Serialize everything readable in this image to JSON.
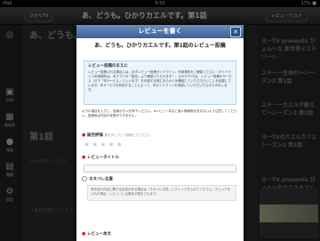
{
  "status": {
    "left": "iPad",
    "time": "9:53",
    "battery": "17% ■"
  },
  "topbar": {
    "tag": "ひかりTV",
    "title": "あ、どうも。ひかりカエルです。第1話",
    "right_button": "レビューリスト"
  },
  "sidebar": {
    "items": [
      {
        "label": "",
        "icon": "home-icon"
      },
      {
        "label": "VOD",
        "icon": "vod-icon"
      },
      {
        "label": "番組表",
        "icon": "program-guide-icon"
      },
      {
        "label": "録画",
        "icon": "recording-icon"
      },
      {
        "label": "書籍",
        "icon": "books-icon"
      },
      {
        "label": "設定",
        "icon": "settings-icon"
      }
    ]
  },
  "background": {
    "heading1": "あ、どうも。ひかりカエルです。第1話",
    "heading2": "第1話",
    "heading3": "ひかりTV、アニメ",
    "text": "「世界のあちらこちら」「何故に出てきた？」",
    "right_items": [
      "ヨーTV presents ぴょん〜な 新世界ミステリーシ",
      "ステーー生命の〜シーズン2 第1話",
      "ステーーカエルが教えて〜シーズン2 第1話",
      "ヨーTVのカエルカフェ シーズン2 第1話",
      "ヨーTV presents ぴょん〜なカエルカフェ シーズン2 第3話"
    ]
  },
  "modal": {
    "header_title": "レビューを書く",
    "close_label": "✕",
    "title": "あ、どうも。ひかりカエルです。第1話のレビュー投稿",
    "notice_heading": "レビュー投稿のまえに",
    "notice_body": "レビュー投稿される場合には、必ずレビュー投稿ガイドライン、利用規約をご確認ください（ガイドライン利用規約は、本アプリの「設定」より確認いただけます）。ひかりTVでは、レビュー投稿のサービス（以下「本サービス」といいます）を利用する際にあらかじめ確認していただきたいことを記載しています。本サービスを利用することによって、本ガイドラインを承認していただいたものとみなします。",
    "notice_highlight": "（ガイドライン利用規約は、本アプリの「設定」より確認いただけます）",
    "note": "以下の項目を入力し、投稿ボタンを押下ください。※レビュー本文に個人情報等を含まないよう注意してください。投稿後は内容の変更ができません。",
    "sections": {
      "rating": "総合評価",
      "rating_sub": "星をタップして評価してください",
      "review_title": "レビュータイトル",
      "spoiler": "ネタバレ注意",
      "body": "レビュー本文"
    },
    "spoiler_text": "本作品の内容に関する記述がある場合は「ネタバレ注意」にチェックを入れてください。チェックを入れた場合、レビューには警告が表示されます。",
    "stars": "★★★★★"
  },
  "colors": {
    "modal_header": "#3c5f99",
    "accent_red": "#cc3333"
  }
}
